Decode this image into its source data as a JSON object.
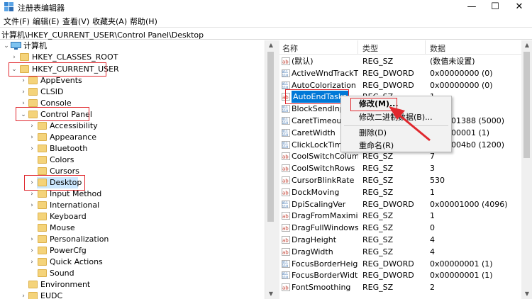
{
  "window": {
    "title": "注册表编辑器",
    "minimize": "—",
    "maximize": "☐",
    "close": "✕"
  },
  "menu": [
    "文件(F)",
    "编辑(E)",
    "查看(V)",
    "收藏夹(A)",
    "帮助(H)"
  ],
  "address": "计算机\\HKEY_CURRENT_USER\\Control Panel\\Desktop",
  "colors": {
    "highlight_box": "#e0282e",
    "selection_blue": "#0078d7",
    "folder": "#f4d37a"
  },
  "tree": {
    "root": "计算机",
    "hives": [
      {
        "label": "HKEY_CLASSES_ROOT",
        "state": "collapsed"
      },
      {
        "label": "HKEY_CURRENT_USER",
        "state": "expanded",
        "highlighted": true
      }
    ],
    "hkcu_children": [
      "AppEvents",
      "CLSID",
      "Console"
    ],
    "control_panel": {
      "label": "Control Panel",
      "state": "expanded",
      "highlighted": true
    },
    "cp_children": [
      "Accessibility",
      "Appearance",
      "Bluetooth",
      "Colors",
      "Cursors",
      "Desktop",
      "Input Method",
      "International",
      "Keyboard",
      "Mouse",
      "Personalization",
      "PowerCfg",
      "Quick Actions",
      "Sound"
    ],
    "selected": "Desktop",
    "after": [
      "Environment",
      "EUDC"
    ]
  },
  "list": {
    "headers": {
      "name": "名称",
      "type": "类型",
      "data": "数据"
    },
    "rows": [
      {
        "name": "(默认)",
        "type": "REG_SZ",
        "data": "(数值未设置)",
        "icon": "string-value-icon"
      },
      {
        "name": "ActiveWndTrackTi...",
        "type": "REG_DWORD",
        "data": "0x00000000 (0)",
        "icon": "binary-value-icon"
      },
      {
        "name": "AutoColorization",
        "type": "REG_DWORD",
        "data": "0x00000000 (0)",
        "icon": "binary-value-icon"
      },
      {
        "name": "AutoEndTasks",
        "type": "REG_SZ",
        "data": "1",
        "icon": "string-value-icon",
        "selected": true
      },
      {
        "name": "BlockSendInpu",
        "type": "",
        "data": "",
        "icon": "binary-value-icon"
      },
      {
        "name": "CaretTimeout",
        "type": "",
        "data": "01388 (5000)",
        "icon": "binary-value-icon"
      },
      {
        "name": "CaretWidth",
        "type": "",
        "data": "00001 (1)",
        "icon": "binary-value-icon"
      },
      {
        "name": "ClickLockTime",
        "type": "",
        "data": "004b0 (1200)",
        "icon": "binary-value-icon"
      },
      {
        "name": "CoolSwitchColumns",
        "type": "REG_SZ",
        "data": "7",
        "icon": "string-value-icon"
      },
      {
        "name": "CoolSwitchRows",
        "type": "REG_SZ",
        "data": "3",
        "icon": "string-value-icon"
      },
      {
        "name": "CursorBlinkRate",
        "type": "REG_SZ",
        "data": "530",
        "icon": "string-value-icon"
      },
      {
        "name": "DockMoving",
        "type": "REG_SZ",
        "data": "1",
        "icon": "string-value-icon"
      },
      {
        "name": "DpiScalingVer",
        "type": "REG_DWORD",
        "data": "0x00001000 (4096)",
        "icon": "binary-value-icon"
      },
      {
        "name": "DragFromMaximize",
        "type": "REG_SZ",
        "data": "1",
        "icon": "string-value-icon"
      },
      {
        "name": "DragFullWindows",
        "type": "REG_SZ",
        "data": "0",
        "icon": "string-value-icon"
      },
      {
        "name": "DragHeight",
        "type": "REG_SZ",
        "data": "4",
        "icon": "string-value-icon"
      },
      {
        "name": "DragWidth",
        "type": "REG_SZ",
        "data": "4",
        "icon": "string-value-icon"
      },
      {
        "name": "FocusBorderHeight",
        "type": "REG_DWORD",
        "data": "0x00000001 (1)",
        "icon": "binary-value-icon"
      },
      {
        "name": "FocusBorderWidth",
        "type": "REG_DWORD",
        "data": "0x00000001 (1)",
        "icon": "binary-value-icon"
      },
      {
        "name": "FontSmoothing",
        "type": "REG_SZ",
        "data": "2",
        "icon": "string-value-icon"
      }
    ]
  },
  "context_menu": [
    "修改(M)...",
    "修改二进制数据(B)...",
    "删除(D)",
    "重命名(R)"
  ]
}
